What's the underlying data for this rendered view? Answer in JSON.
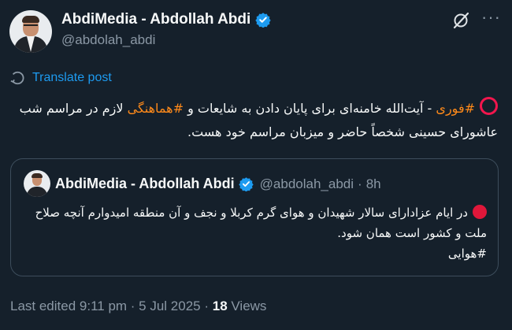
{
  "author": {
    "display_name": "AbdiMedia - Abdollah Abdi",
    "handle": "@abdolah_abdi"
  },
  "icons": {
    "verified": "verified-badge-icon",
    "grok": "grok-icon",
    "more": "more-options-icon",
    "translate": "translate-globe-icon"
  },
  "colors": {
    "background": "#15202b",
    "accent": "#1d9bf0",
    "hashtag": "#ff8a1a",
    "secondary_text": "#8b98a5"
  },
  "translate_label": "Translate post",
  "tweet": {
    "prefix": "⭕",
    "hashtag1": "#فوری",
    "text1": " - آیت‌الله خامنه‌ای برای پایان دادن به شایعات و ",
    "hashtag2": "#هماهنگی",
    "text2": " لازم در مراسم شب عاشورای حسینی شخصاً حاضر و میزبان مراسم خود هست."
  },
  "quoted": {
    "display_name": "AbdiMedia - Abdollah Abdi",
    "handle": "@abdolah_abdi",
    "dot": "·",
    "time": "8h",
    "text": "در ایام عزادارای سالار شهیدان و هوای گرم کربلا و نجف و آن منطقه امیدوارم آنچه صلاح ملت و کشور است همان شود.",
    "hashtag": "#هوایی"
  },
  "meta": {
    "edited": "Last edited 9:11 pm · 5 Jul 2025 · ",
    "views_count": "18",
    "views_label": " Views"
  }
}
